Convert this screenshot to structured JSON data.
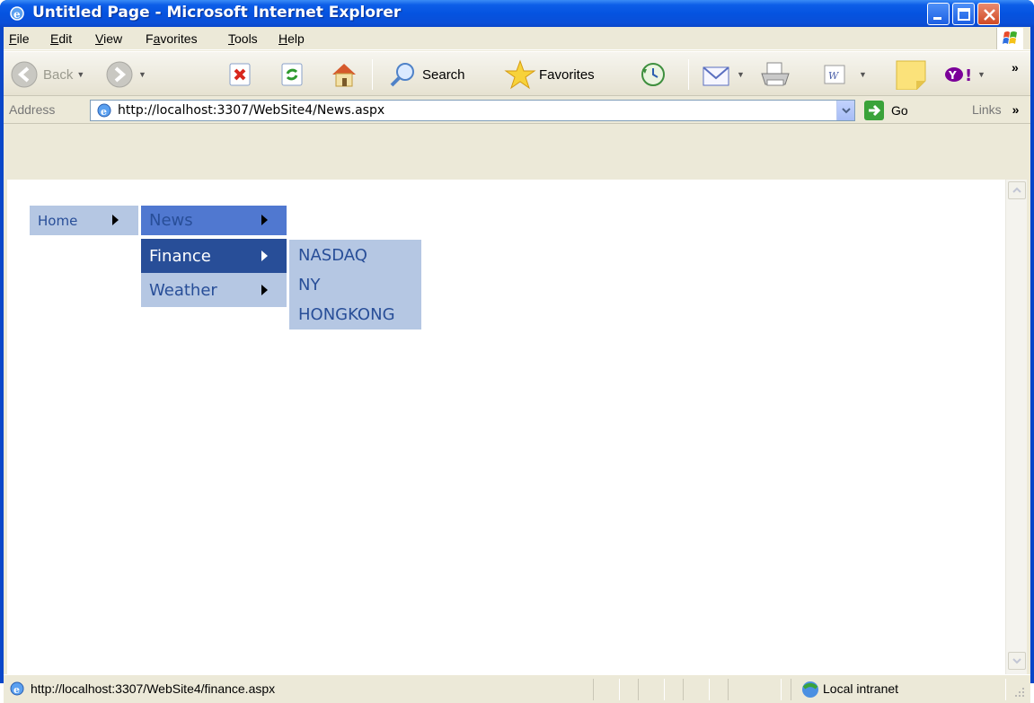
{
  "window": {
    "title": "Untitled Page - Microsoft Internet Explorer"
  },
  "menubar": {
    "items": [
      {
        "label": "File",
        "accel": "F"
      },
      {
        "label": "Edit",
        "accel": "E"
      },
      {
        "label": "View",
        "accel": "V"
      },
      {
        "label": "Favorites",
        "accel": "a"
      },
      {
        "label": "Tools",
        "accel": "T"
      },
      {
        "label": "Help",
        "accel": "H"
      }
    ]
  },
  "toolbar": {
    "back_label": "Back",
    "search_label": "Search",
    "favorites_label": "Favorites",
    "overflow": "»"
  },
  "addressbar": {
    "label": "Address",
    "url": "http://localhost:3307/WebSite4/News.aspx",
    "go_label": "Go",
    "links_label": "Links",
    "links_overflow": "»"
  },
  "menu": {
    "root": "Home",
    "level1": [
      "News",
      "Finance",
      "Weather"
    ],
    "level2": [
      "NASDAQ",
      "NY",
      "HONGKONG"
    ]
  },
  "statusbar": {
    "url": "http://localhost:3307/WebSite4/finance.aspx",
    "zone": "Local intranet"
  },
  "colors": {
    "menu_light": "#b5c7e3",
    "menu_mid": "#5078d0",
    "menu_dark": "#284e98",
    "titlebar": "#0553e0"
  },
  "icons": {
    "title": "ie-icon",
    "back": "back-arrow-icon",
    "forward": "forward-arrow-icon",
    "stop": "stop-icon",
    "refresh": "refresh-icon",
    "home": "home-icon",
    "search": "search-icon",
    "favorites": "star-icon",
    "history": "history-icon",
    "mail": "mail-icon",
    "print": "printer-icon",
    "edit": "word-edit-icon",
    "notes": "sticky-note-icon",
    "yahoo": "yahoo-icon",
    "go": "go-arrow-icon",
    "zone": "intranet-icon"
  }
}
